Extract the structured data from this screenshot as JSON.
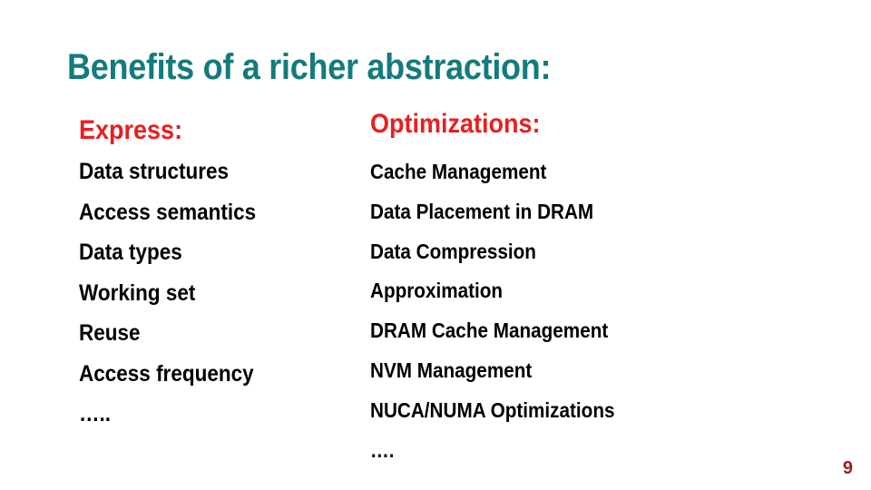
{
  "slide": {
    "title": "Benefits of a richer abstraction:",
    "colors": {
      "title": "#137b7b",
      "heading": "#e81f1f",
      "body": "#000000",
      "page_number": "#9b1c1c"
    },
    "express": {
      "heading": "Express:",
      "items": [
        "Data structures",
        "Access semantics",
        "Data types",
        "Working set",
        "Reuse",
        "Access frequency",
        "….."
      ]
    },
    "optimizations": {
      "heading": "Optimizations:",
      "items": [
        "Cache Management",
        "Data Placement in DRAM",
        "Data Compression",
        "Approximation",
        "DRAM Cache Management",
        "NVM Management",
        "NUCA/NUMA Optimizations",
        "…."
      ]
    },
    "page_number": "9"
  }
}
